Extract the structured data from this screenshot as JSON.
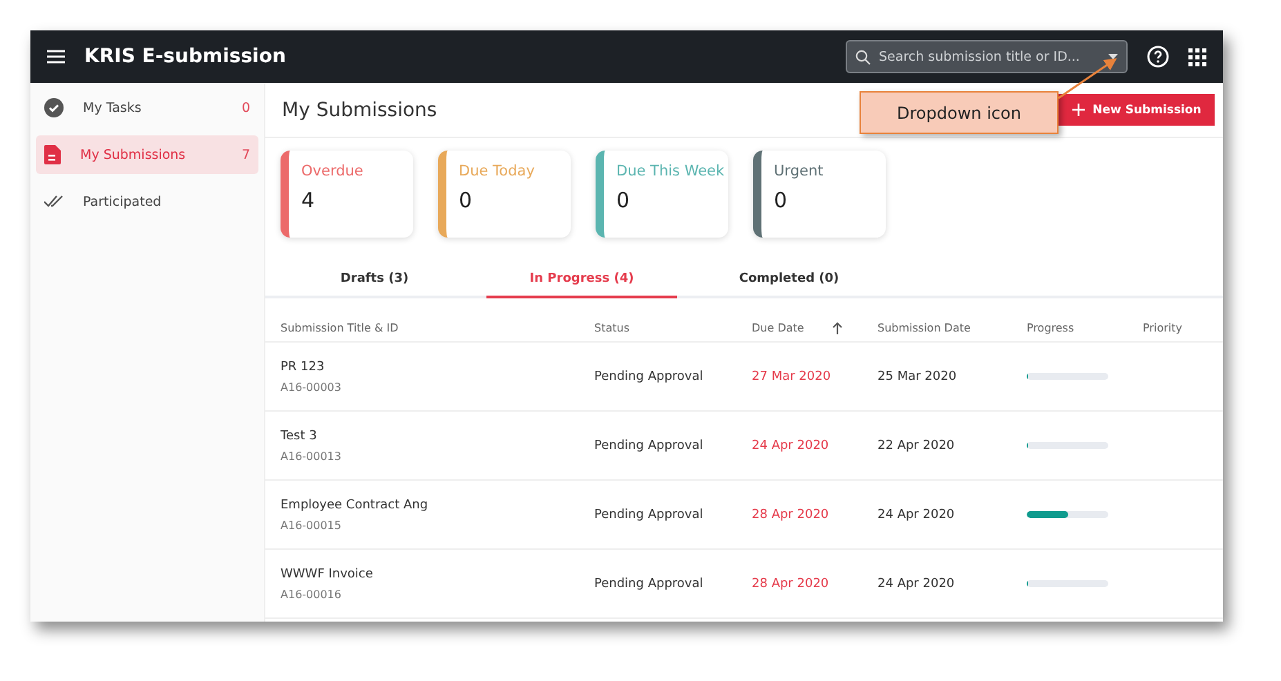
{
  "app": {
    "title": "KRIS E-submission",
    "search": {
      "placeholder": "Search submission title or ID..."
    }
  },
  "sidebar": {
    "items": [
      {
        "label": "My Tasks",
        "count": "0",
        "selected": false
      },
      {
        "label": "My Submissions",
        "count": "7",
        "selected": true
      },
      {
        "label": "Participated",
        "selected": false
      }
    ]
  },
  "page": {
    "title": "My Submissions",
    "new_button": "New Submission"
  },
  "stats": [
    {
      "label": "Overdue",
      "value": "4",
      "color": "#ec6a6a"
    },
    {
      "label": "Due Today",
      "value": "0",
      "color": "#e8a95a"
    },
    {
      "label": "Due This Week",
      "value": "0",
      "color": "#5bb5b0"
    },
    {
      "label": "Urgent",
      "value": "0",
      "color": "#5f7175"
    }
  ],
  "tabs": [
    {
      "label": "Drafts (3)",
      "selected": false
    },
    {
      "label": "In Progress (4)",
      "selected": true
    },
    {
      "label": "Completed (0)",
      "selected": false
    }
  ],
  "table": {
    "columns": [
      "Submission Title & ID",
      "Status",
      "Due Date",
      "Submission Date",
      "Progress",
      "Priority"
    ],
    "rows": [
      {
        "title": "PR 123",
        "id": "A16-00003",
        "status": "Pending Approval",
        "due": "27 Mar 2020",
        "submitted": "25 Mar 2020",
        "level": 0
      },
      {
        "title": "Test 3",
        "id": "A16-00013",
        "status": "Pending Approval",
        "due": "24 Apr 2020",
        "submitted": "22 Apr 2020",
        "level": 0
      },
      {
        "title": "Employee Contract Ang",
        "id": "A16-00015",
        "status": "Pending Approval",
        "due": "28 Apr 2020",
        "submitted": "24 Apr 2020",
        "level": 0.5
      },
      {
        "title": "WWWF Invoice",
        "id": "A16-00016",
        "status": "Pending Approval",
        "due": "28 Apr 2020",
        "submitted": "24 Apr 2020",
        "level": 0
      }
    ]
  },
  "annotation": {
    "label": "Dropdown icon"
  }
}
